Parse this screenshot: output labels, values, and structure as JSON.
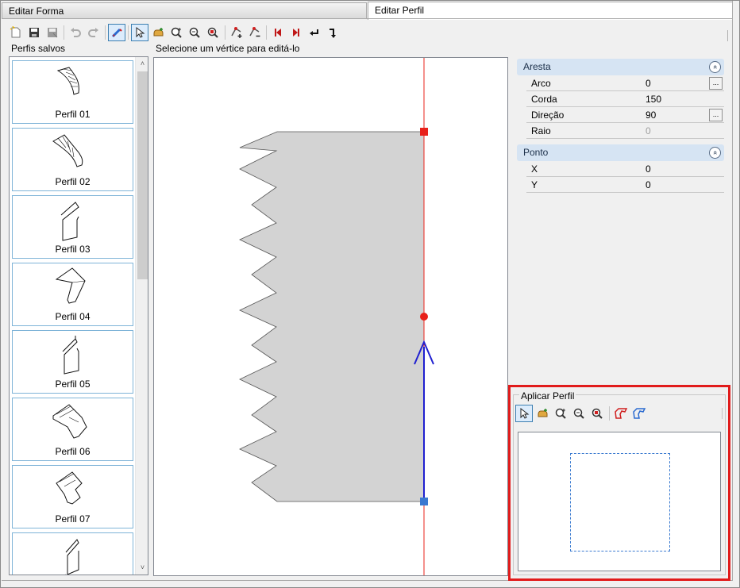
{
  "tabs": [
    {
      "label": "Editar Forma"
    },
    {
      "label": "Editar Perfil"
    }
  ],
  "toolbar": {
    "icons": [
      "new-icon",
      "save-icon",
      "save-as-icon",
      "undo-icon",
      "redo-icon",
      "edit-mode-icon",
      "select-icon",
      "pan-icon",
      "zoom-in-icon",
      "zoom-extents-icon",
      "zoom-window-icon",
      "add-vertex-icon",
      "remove-vertex-icon",
      "first-vertex-icon",
      "last-vertex-icon",
      "reverse-icon",
      "flip-icon"
    ]
  },
  "saved_profiles": {
    "label": "Perfis salvos",
    "items": [
      {
        "label": "Perfil 01"
      },
      {
        "label": "Perfil 02"
      },
      {
        "label": "Perfil 03"
      },
      {
        "label": "Perfil 04"
      },
      {
        "label": "Perfil 05"
      },
      {
        "label": "Perfil 06"
      },
      {
        "label": "Perfil 07"
      },
      {
        "label": ""
      }
    ]
  },
  "editor": {
    "hint": "Selecione um vértice para editá-lo"
  },
  "properties": {
    "aresta": {
      "title": "Aresta",
      "rows": [
        {
          "name": "Arco",
          "value": "0"
        },
        {
          "name": "Corda",
          "value": "150"
        },
        {
          "name": "Direção",
          "value": "90"
        },
        {
          "name": "Raio",
          "value": "0"
        }
      ]
    },
    "ponto": {
      "title": "Ponto",
      "rows": [
        {
          "name": "X",
          "value": "0"
        },
        {
          "name": "Y",
          "value": "0"
        }
      ]
    },
    "ellipsis": "...",
    "collapse": "»"
  },
  "apply_profile": {
    "title": "Aplicar Perfil",
    "icons": [
      "select-icon",
      "pan-icon",
      "zoom-in-icon",
      "zoom-extents-icon",
      "zoom-window-icon",
      "profile-red-icon",
      "profile-blue-icon"
    ]
  },
  "scroll": {
    "up": "˄",
    "down": "˅"
  },
  "colors": {
    "axis": "#e8201a",
    "selected_edge": "#2020d0",
    "vertex_red": "#e8201a",
    "vertex_blue": "#3a78d0",
    "shape_fill": "#d3d3d3",
    "highlight": "#e11b1b"
  }
}
